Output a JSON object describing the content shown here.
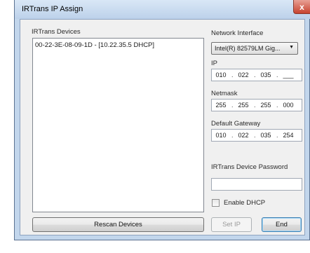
{
  "window": {
    "title": "IRTrans IP Assign",
    "close_glyph": "x"
  },
  "devices": {
    "label": "IRTrans Devices",
    "items": [
      "00-22-3E-08-09-1D  -  [10.22.35.5 DHCP]"
    ]
  },
  "network_interface": {
    "label": "Network Interface",
    "selected": "Intel(R) 82579LM Gig..."
  },
  "ip": {
    "label": "IP",
    "octets": [
      "010",
      "022",
      "035",
      "___"
    ]
  },
  "netmask": {
    "label": "Netmask",
    "octets": [
      "255",
      "255",
      "255",
      "000"
    ]
  },
  "gateway": {
    "label": "Default Gateway",
    "octets": [
      "010",
      "022",
      "035",
      "254"
    ]
  },
  "password": {
    "label": "IRTrans Device Password",
    "value": ""
  },
  "dhcp": {
    "label": "Enable DHCP",
    "checked": false
  },
  "buttons": {
    "rescan": "Rescan Devices",
    "set_ip": "Set IP",
    "end": "End"
  },
  "icons": {
    "combo_arrow": "chevron-down-icon",
    "close": "close-icon"
  },
  "colors": {
    "frame": "#c2d6ec",
    "client": "#f0f0f0",
    "close": "#c7432f"
  }
}
